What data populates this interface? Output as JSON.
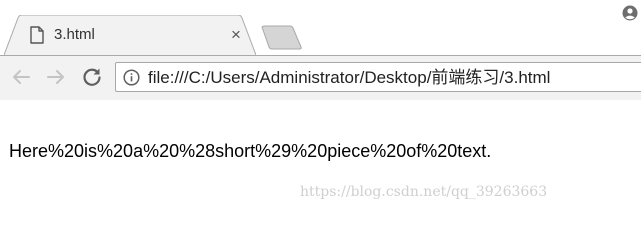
{
  "tab": {
    "title": "3.html",
    "close_symbol": "×",
    "icon": "file-icon"
  },
  "toolbar": {
    "back_icon": "arrow-left-icon",
    "forward_icon": "arrow-right-icon",
    "reload_icon": "reload-icon",
    "info_icon": "info-icon",
    "url": "file:///C:/Users/Administrator/Desktop/前端练习/3.html"
  },
  "profile_icon": "user-icon",
  "page": {
    "text": "Here%20is%20a%20%28short%29%20piece%20of%20text."
  },
  "watermark": "https://blog.csdn.net/qq_39263663",
  "colors": {
    "toolbar_bg": "#f2f2f2",
    "tab_bg": "#f2f2f2",
    "inactive_tab": "#d5d5d5",
    "nav_disabled": "#c4c4c4",
    "nav_active": "#5f5f5f"
  }
}
